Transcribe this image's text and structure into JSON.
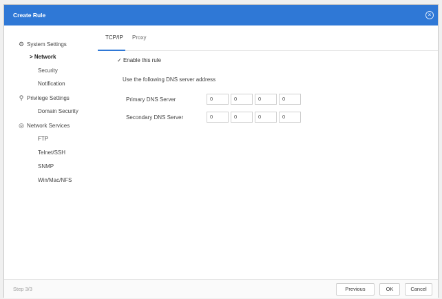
{
  "dialog": {
    "title": "Create Rule"
  },
  "sidebar": {
    "items": [
      {
        "label": "System Settings",
        "icon": "gear-icon"
      },
      {
        "label": "Network",
        "prefix": ">"
      },
      {
        "label": "Security"
      },
      {
        "label": "Notification"
      },
      {
        "label": "Privilege Settings",
        "icon": "user-icon"
      },
      {
        "label": "Domain Security"
      },
      {
        "label": "Network Services",
        "icon": "network-icon"
      },
      {
        "label": "FTP"
      },
      {
        "label": "Telnet/SSH"
      },
      {
        "label": "SNMP"
      },
      {
        "label": "Win/Mac/NFS"
      }
    ]
  },
  "tabs": [
    {
      "label": "TCP/IP"
    },
    {
      "label": "Proxy"
    }
  ],
  "form": {
    "enable_label": "Enable this rule",
    "enable_checked": true,
    "dns_heading": "Use the following DNS server address",
    "primary_label": "Primary DNS Server",
    "secondary_label": "Secondary DNS Server",
    "primary_ip": [
      "0",
      "0",
      "0",
      "0"
    ],
    "secondary_ip": [
      "0",
      "0",
      "0",
      "0"
    ]
  },
  "footer": {
    "step": "Step 3/3",
    "previous_label": "Previous",
    "ok_label": "OK",
    "cancel_label": "Cancel"
  },
  "colors": {
    "accent": "#2f78d6"
  }
}
